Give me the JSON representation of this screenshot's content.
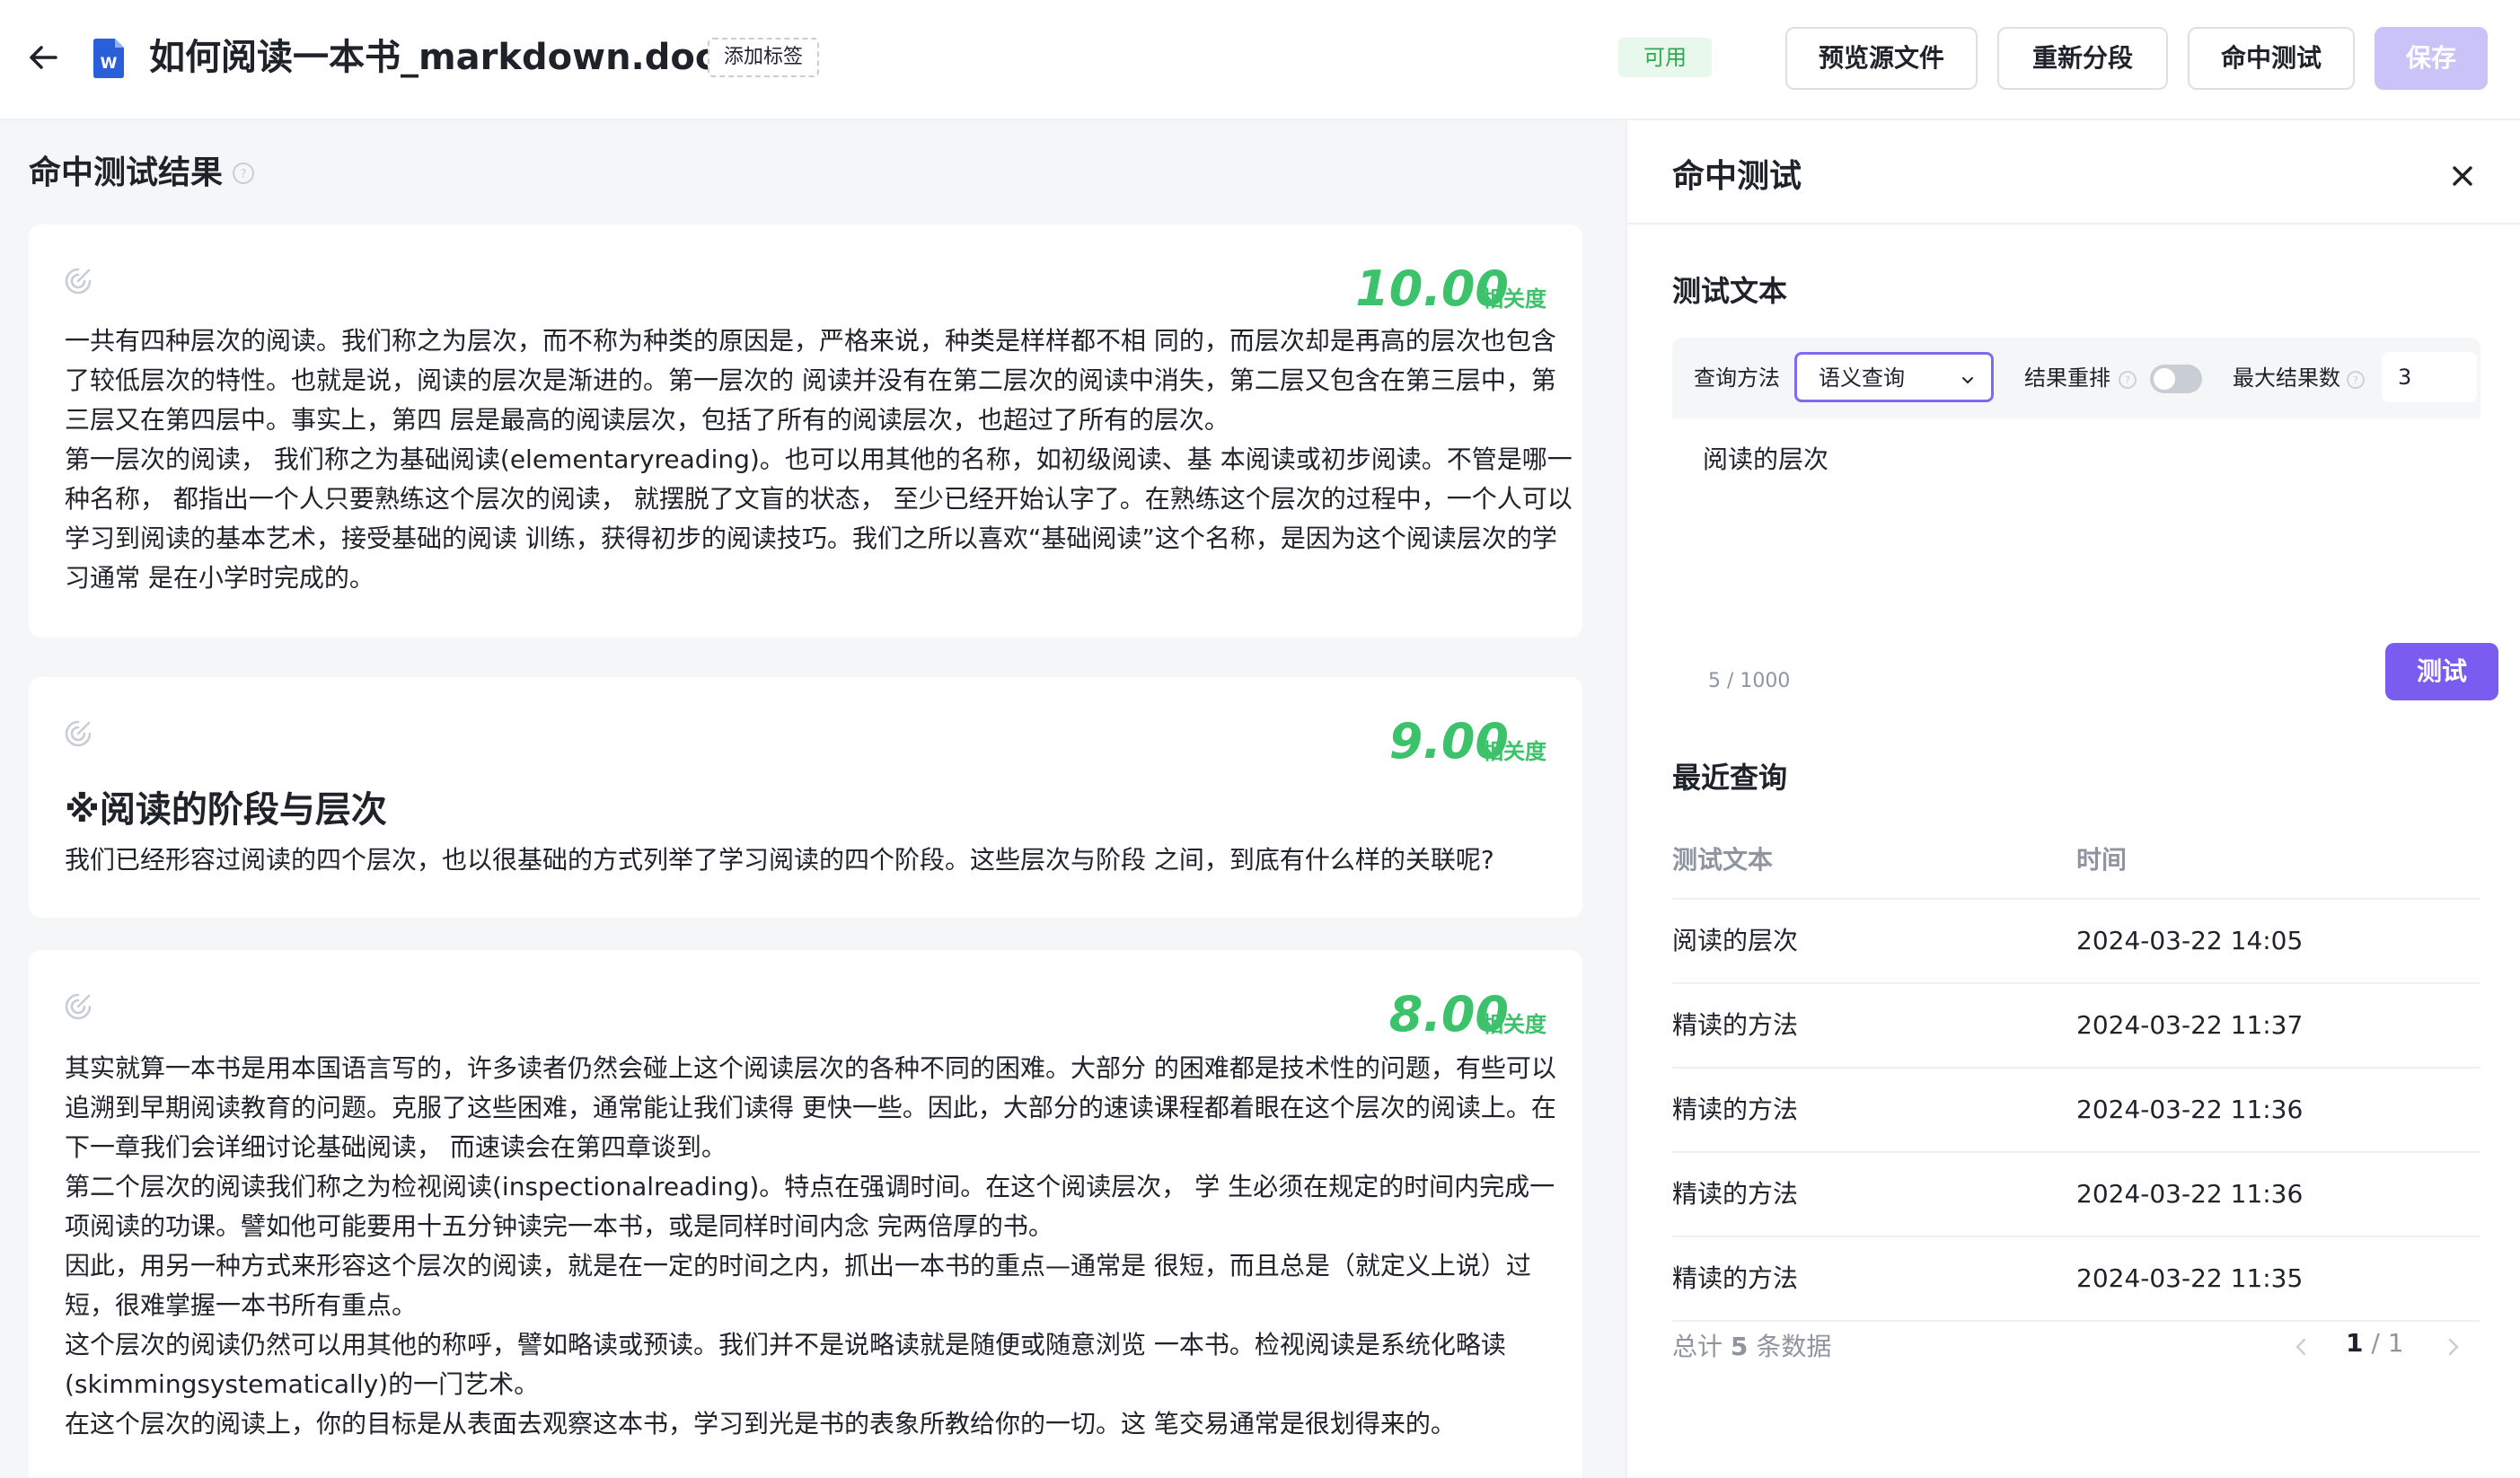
{
  "header": {
    "title": "如何阅读一本书_markdown.docx",
    "doc_icon_letter": "W",
    "add_tag_label": "添加标签",
    "status_label": "可用",
    "buttons": {
      "preview": "预览源文件",
      "resegment": "重新分段",
      "hit_test": "命中测试",
      "save": "保存"
    }
  },
  "results": {
    "title": "命中测试结果",
    "relevance_label": "相关度",
    "cards": [
      {
        "score": "10.00",
        "paragraphs": [
          "一共有四种层次的阅读。我们称之为层次，而不称为种类的原因是，严格来说，种类是样样都不相 同的，而层次却是再高的层次也包含了较低层次的特性。也就是说，阅读的层次是渐进的。第一层次的 阅读并没有在第二层次的阅读中消失，第二层又包含在第三层中，第三层又在第四层中。事实上，第四 层是最高的阅读层次，包括了所有的阅读层次，也超过了所有的层次。",
          "第一层次的阅读， 我们称之为基础阅读(elementaryreading)。也可以用其他的名称，如初级阅读、基 本阅读或初步阅读。不管是哪一种名称， 都指出一个人只要熟练这个层次的阅读， 就摆脱了文盲的状态， 至少已经开始认字了。在熟练这个层次的过程中，一个人可以学习到阅读的基本艺术，接受基础的阅读 训练，获得初步的阅读技巧。我们之所以喜欢“基础阅读”这个名称，是因为这个阅读层次的学习通常 是在小学时完成的。"
        ]
      },
      {
        "score": "9.00",
        "heading": "※阅读的阶段与层次",
        "paragraphs": [
          "我们已经形容过阅读的四个层次，也以很基础的方式列举了学习阅读的四个阶段。这些层次与阶段 之间，到底有什么样的关联呢?"
        ]
      },
      {
        "score": "8.00",
        "paragraphs": [
          "其实就算一本书是用本国语言写的，许多读者仍然会碰上这个阅读层次的各种不同的困难。大部分 的困难都是技术性的问题，有些可以追溯到早期阅读教育的问题。克服了这些困难，通常能让我们读得 更快一些。因此，大部分的速读课程都着眼在这个层次的阅读上。在下一章我们会详细讨论基础阅读， 而速读会在第四章谈到。",
          "第二个层次的阅读我们称之为检视阅读(inspectionalreading)。特点在强调时间。在这个阅读层次， 学 生必须在规定的时间内完成一项阅读的功课。譬如他可能要用十五分钟读完一本书，或是同样时间内念 完两倍厚的书。",
          "因此，用另一种方式来形容这个层次的阅读，就是在一定的时间之内，抓出一本书的重点—通常是 很短，而且总是（就定义上说）过短，很难掌握一本书所有重点。",
          "这个层次的阅读仍然可以用其他的称呼，譬如略读或预读。我们并不是说略读就是随便或随意浏览 一本书。检视阅读是系统化略读(skimmingsystematically)的一门艺术。",
          "在这个层次的阅读上，你的目标是从表面去观察这本书，学习到光是书的表象所教给你的一切。这 笔交易通常是很划得来的。"
        ]
      }
    ]
  },
  "panel": {
    "title": "命中测试",
    "test_text_title": "测试文本",
    "query_method_label": "查询方法",
    "query_method_value": "语义查询",
    "rerank_label": "结果重排",
    "rerank_enabled": false,
    "max_results_label": "最大结果数",
    "max_results_value": "3",
    "query_text": "阅读的层次",
    "char_count": "5 / 1000",
    "test_button": "测试",
    "recent_title": "最近查询",
    "table_headers": [
      "测试文本",
      "时间"
    ],
    "recent_queries": [
      {
        "text": "阅读的层次",
        "time": "2024-03-22 14:05"
      },
      {
        "text": "精读的方法",
        "time": "2024-03-22 11:37"
      },
      {
        "text": "精读的方法",
        "time": "2024-03-22 11:36"
      },
      {
        "text": "精读的方法",
        "time": "2024-03-22 11:36"
      },
      {
        "text": "精读的方法",
        "time": "2024-03-22 11:35"
      }
    ],
    "total_prefix": "总计",
    "total_count": "5",
    "total_suffix": "条数据",
    "page_current": "1",
    "page_total": "1"
  },
  "colors": {
    "accent": "#7b5cf0",
    "score_green": "#3cc26a",
    "status_bg": "#e8f8ec",
    "doc_blue": "#2b5fd9"
  },
  "icons": [
    "back-arrow-icon",
    "word-doc-icon",
    "help-icon",
    "snippet-target-icon",
    "close-icon",
    "chevron-down-icon",
    "chevron-left-icon",
    "chevron-right-icon"
  ]
}
